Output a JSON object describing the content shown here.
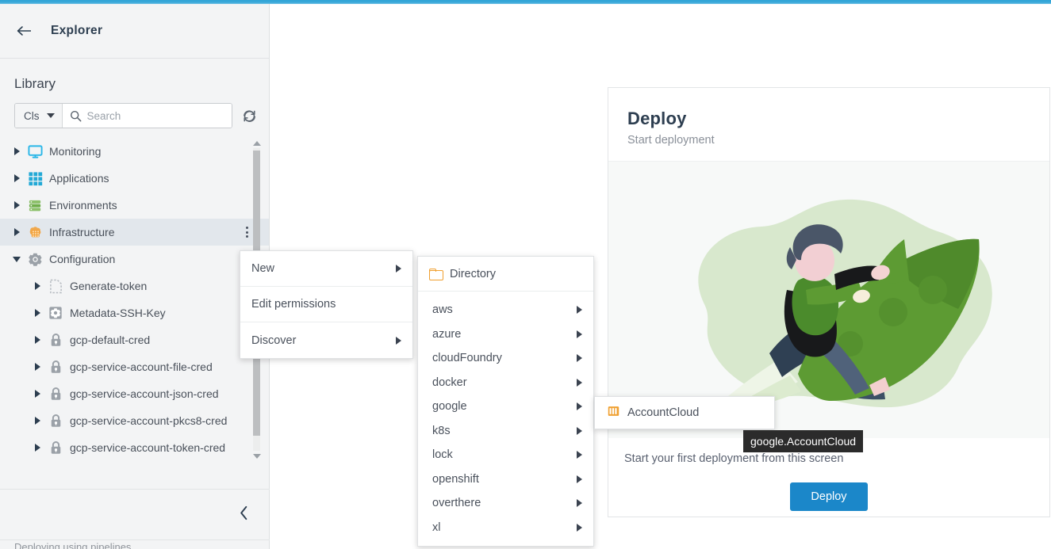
{
  "theme": {
    "accent_bar": "#2fa3d6",
    "primary_button": "#1b87c9",
    "selected_row": "#e2e7ec",
    "tooltip_bg": "#2b2b2b"
  },
  "sidebar": {
    "back_icon": "arrow-left-icon",
    "header_title": "Explorer",
    "section_title": "Library",
    "filter": {
      "type_label": "Cls",
      "caret_icon": "chevron-down-icon",
      "search_icon": "search-icon",
      "search_placeholder": "Search",
      "search_value": "",
      "refresh_icon": "refresh-icon"
    },
    "tree": [
      {
        "label": "Monitoring",
        "icon": "monitor-icon",
        "indent": 0,
        "expanded": false,
        "selected": false
      },
      {
        "label": "Applications",
        "icon": "grid-icon",
        "indent": 0,
        "expanded": false,
        "selected": false
      },
      {
        "label": "Environments",
        "icon": "servers-icon",
        "indent": 0,
        "expanded": false,
        "selected": false
      },
      {
        "label": "Infrastructure",
        "icon": "infrastructure-icon",
        "indent": 0,
        "expanded": false,
        "selected": true
      },
      {
        "label": "Configuration",
        "icon": "gear-icon",
        "indent": 0,
        "expanded": true,
        "selected": false
      },
      {
        "label": "Generate-token",
        "icon": "dashed-file-icon",
        "indent": 1,
        "expanded": false,
        "selected": false
      },
      {
        "label": "Metadata-SSH-Key",
        "icon": "gear-square-icon",
        "indent": 1,
        "expanded": false,
        "selected": false
      },
      {
        "label": "gcp-default-cred",
        "icon": "lock-icon",
        "indent": 1,
        "expanded": false,
        "selected": false
      },
      {
        "label": "gcp-service-account-file-cred",
        "icon": "lock-icon",
        "indent": 1,
        "expanded": false,
        "selected": false
      },
      {
        "label": "gcp-service-account-json-cred",
        "icon": "lock-icon",
        "indent": 1,
        "expanded": false,
        "selected": false
      },
      {
        "label": "gcp-service-account-pkcs8-cred",
        "icon": "lock-icon",
        "indent": 1,
        "expanded": false,
        "selected": false
      },
      {
        "label": "gcp-service-account-token-cred",
        "icon": "lock-icon",
        "indent": 1,
        "expanded": false,
        "selected": false
      }
    ],
    "scrollbar": {
      "up_icon": "triangle-up-icon",
      "down_icon": "triangle-down-icon"
    },
    "collapse_icon": "chevron-left-icon",
    "footer_hint": "Deploying using pipelines"
  },
  "context_menu": {
    "items": [
      {
        "label": "New",
        "has_submenu": true
      },
      {
        "label": "Edit permissions",
        "has_submenu": false
      },
      {
        "label": "Discover",
        "has_submenu": true
      }
    ]
  },
  "new_submenu": {
    "directory": {
      "label": "Directory",
      "icon": "folder-icon"
    },
    "items": [
      {
        "label": "aws",
        "has_submenu": true
      },
      {
        "label": "azure",
        "has_submenu": true
      },
      {
        "label": "cloudFoundry",
        "has_submenu": true
      },
      {
        "label": "docker",
        "has_submenu": true
      },
      {
        "label": "google",
        "has_submenu": true
      },
      {
        "label": "k8s",
        "has_submenu": true
      },
      {
        "label": "lock",
        "has_submenu": true
      },
      {
        "label": "openshift",
        "has_submenu": true
      },
      {
        "label": "overthere",
        "has_submenu": true
      },
      {
        "label": "xl",
        "has_submenu": true
      }
    ]
  },
  "google_submenu": {
    "items": [
      {
        "label": "AccountCloud",
        "icon": "account-cloud-icon"
      }
    ]
  },
  "tooltip": {
    "text": "google.AccountCloud"
  },
  "deploy_card": {
    "title": "Deploy",
    "subtitle": "Start deployment",
    "illustration": "rocket-illustration",
    "description": "Start your first deployment from this screen",
    "button_label": "Deploy"
  }
}
